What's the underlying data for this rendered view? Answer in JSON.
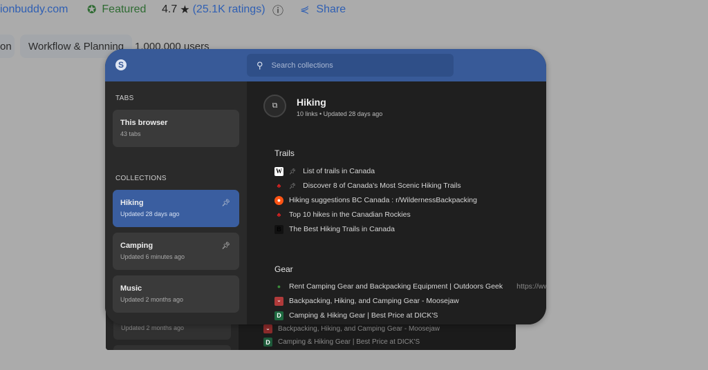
{
  "store": {
    "site": "ionbuddy.com",
    "featured": "Featured",
    "rating": "4.7",
    "star": "★",
    "ratings_count": "(25.1K ratings)",
    "share": "Share",
    "chips": [
      "on",
      "Workflow & Planning"
    ],
    "users": "1,000,000 users"
  },
  "header": {
    "search_placeholder": "Search collections"
  },
  "sidebar": {
    "tabs_heading": "TABS",
    "browser": {
      "title": "This browser",
      "sub": "43 tabs"
    },
    "collections_heading": "COLLECTIONS",
    "collections": [
      {
        "title": "Hiking",
        "sub": "Updated 28 days ago",
        "pinned": true,
        "active": true
      },
      {
        "title": "Camping",
        "sub": "Updated 6 minutes ago",
        "pinned": true
      },
      {
        "title": "Music",
        "sub": "Updated 2 months ago"
      }
    ]
  },
  "main": {
    "title": "Hiking",
    "links_count": "10 links",
    "updated": "Updated 28 days ago",
    "groups": [
      {
        "title": "Trails",
        "links": [
          {
            "text": "List of trails in Canada",
            "icon": "wikipedia-icon",
            "pinned": true
          },
          {
            "text": "Discover 8 of Canada's Most Scenic Hiking Trails",
            "icon": "maple-leaf-icon",
            "pinned": true
          },
          {
            "text": "Hiking suggestions BC Canada : r/WildernessBackpacking",
            "icon": "reddit-icon"
          },
          {
            "text": "Top 10 hikes in the Canadian Rockies",
            "icon": "maple-leaf-icon"
          },
          {
            "text": "The Best Hiking Trails in Canada",
            "icon": "b-icon"
          }
        ]
      },
      {
        "title": "Gear",
        "links": [
          {
            "text": "Rent Camping Gear and Backpacking Equipment | Outdoors Geek",
            "icon": "outdoors-geek-icon",
            "url": "https://www"
          },
          {
            "text": "Backpacking, Hiking, and Camping Gear - Moosejaw",
            "icon": "moosejaw-icon"
          },
          {
            "text": "Camping & Hiking Gear | Best Price at DICK'S",
            "icon": "dicks-icon"
          }
        ]
      }
    ]
  },
  "back": {
    "card_sub": "Updated 2 months ago",
    "links": [
      "Backpacking, Hiking, and Camping Gear - Moosejaw",
      "Camping & Hiking Gear | Best Price at DICK'S"
    ]
  },
  "colors": {
    "header": "#385a98",
    "active": "#3a5ea0",
    "featured": "#2e7d32",
    "link": "#2f5fb3"
  }
}
